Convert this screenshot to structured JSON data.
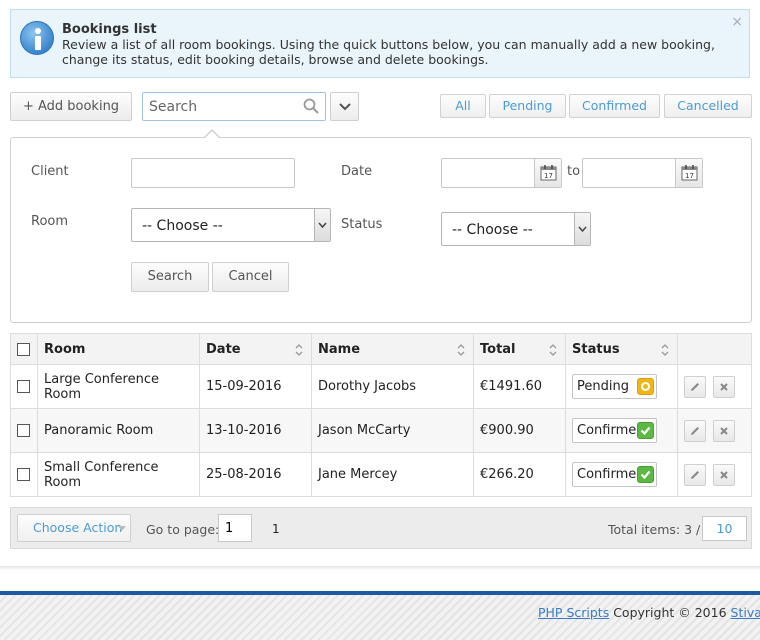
{
  "info": {
    "title": "Bookings list",
    "text": "Review a list of all room bookings. Using the quick buttons below, you can manually add a new booking, change its status, edit booking details, browse and delete bookings.",
    "close_glyph": "×"
  },
  "toolbar": {
    "add_label": "+ Add booking",
    "search_placeholder": "Search",
    "filters": [
      "All",
      "Pending",
      "Confirmed",
      "Cancelled"
    ]
  },
  "search_panel": {
    "client_label": "Client",
    "date_label": "Date",
    "date_to": "to",
    "room_label": "Room",
    "room_value": "-- Choose --",
    "status_label": "Status",
    "status_value": "-- Choose --",
    "search_btn": "Search",
    "cancel_btn": "Cancel"
  },
  "table": {
    "columns": [
      "Room",
      "Date",
      "Name",
      "Total",
      "Status"
    ],
    "rows": [
      {
        "room": "Large Conference Room",
        "date": "15-09-2016",
        "name": "Dorothy Jacobs",
        "total": "€1491.60",
        "status": "Pending"
      },
      {
        "room": "Panoramic Room",
        "date": "13-10-2016",
        "name": "Jason McCarty",
        "total": "€900.90",
        "status": "Confirmed"
      },
      {
        "room": "Small Conference Room",
        "date": "25-08-2016",
        "name": "Jane Mercey",
        "total": "€266.20",
        "status": "Confirmed"
      }
    ]
  },
  "footer_bar": {
    "choose_action": "Choose Action",
    "goto_label": "Go to page:",
    "goto_value": "1",
    "page": "1",
    "total_items": "Total items: 3 /",
    "per_page": "10"
  },
  "footer": {
    "link1": "PHP Scripts",
    "copyright": "Copyright © 2016",
    "link2": "StivaSoft L"
  },
  "colors": {
    "accent": "#4a9bd4",
    "pending": "#f0b619",
    "confirmed": "#5cb842",
    "footer_line": "#1e5aa0"
  }
}
